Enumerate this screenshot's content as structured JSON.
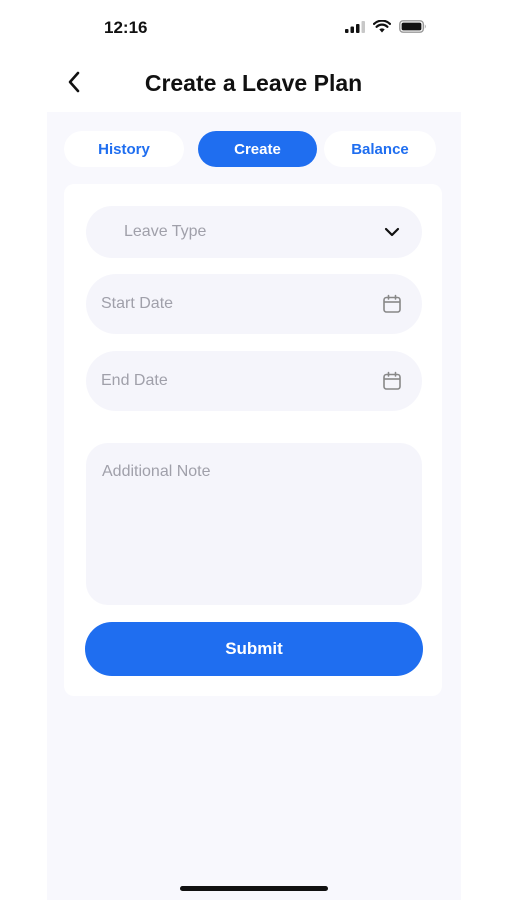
{
  "status_bar": {
    "time": "12:16",
    "icons": [
      "signal-icon",
      "wifi-icon",
      "battery-icon"
    ]
  },
  "header": {
    "title": "Create a Leave Plan",
    "back_icon": "chevron-left-icon"
  },
  "tabs": [
    {
      "label": "History",
      "active": false
    },
    {
      "label": "Create",
      "active": true
    },
    {
      "label": "Balance",
      "active": false
    }
  ],
  "form": {
    "leave_type": {
      "placeholder": "Leave Type",
      "icon": "chevron-down-icon"
    },
    "start_date": {
      "placeholder": "Start Date",
      "icon": "calendar-icon"
    },
    "end_date": {
      "placeholder": "End Date",
      "icon": "calendar-icon"
    },
    "note": {
      "placeholder": "Additional Note"
    },
    "submit_label": "Submit"
  },
  "colors": {
    "accent": "#1f6ef0",
    "panel_bg": "#f8f8fd",
    "field_bg": "#f5f5fb",
    "placeholder": "#a0a0aa",
    "text": "#111111"
  }
}
